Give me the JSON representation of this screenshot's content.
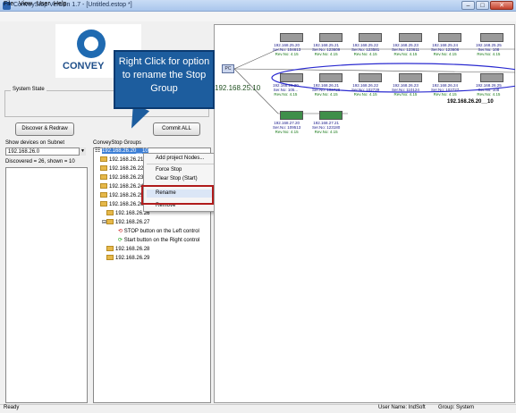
{
  "window": {
    "title": "ConveyStop Version 1.7 - [Untitled.estop *]"
  },
  "menu": [
    "File",
    "View",
    "User",
    "Help"
  ],
  "logo": {
    "text": "CONVEY"
  },
  "callout": {
    "text": "Right Click for option to rename the Stop Group"
  },
  "left": {
    "system_state_label": "System State",
    "discover_button": "Discover & Redraw",
    "commit_button": "Commit ALL",
    "subnet_label": "Show devices on Subnet",
    "subnet_value": "192.168.26.0",
    "discovered_text": "Discovered = 26, shown = 10"
  },
  "tree": {
    "label": "ConveyStop Groups",
    "root": "192.168.26.20__10",
    "rows": [
      "192.168.26.21",
      "192.168.26.22",
      "192.168.26.23",
      "192.168.26.24",
      "192.168.26.25",
      "192.168.26.26",
      "192.168.26.27",
      "STOP button on the Left control",
      "Start button on the Right control",
      "192.168.26.28",
      "192.168.26.29"
    ]
  },
  "context_menu": {
    "items": [
      "Add project Nodes...",
      "Force Stop",
      "Clear Stop (Start)",
      "Rename",
      "Remove"
    ]
  },
  "network": {
    "pc_label": "PC",
    "pc_ip": "192.168.25.10",
    "group_label": "192.168.26.20__10",
    "row1": [
      {
        "ip": "192.168.25.20",
        "ser": "Ser.No: 104613",
        "rev": "Rev.No: 4.15"
      },
      {
        "ip": "192.168.25.21",
        "ser": "Ser.No: 123609",
        "rev": "Rev.No: 4.15"
      },
      {
        "ip": "192.168.25.22",
        "ser": "Ser.No: 123581",
        "rev": "Rev.No: 4.15"
      },
      {
        "ip": "192.168.25.23",
        "ser": "Ser.No: 123611",
        "rev": "Rev.No: 4.15"
      },
      {
        "ip": "192.168.25.24",
        "ser": "Ser.No: 123606",
        "rev": "Rev.No: 4.15"
      },
      {
        "ip": "192.168.25.25",
        "ser": "Ser.No: 108",
        "rev": "Rev.No: 4.15"
      }
    ],
    "row2": [
      {
        "ip": "192.168.26.20",
        "ser": "Ser.No: 105...",
        "rev": "Rev.No: 4.15"
      },
      {
        "ip": "192.168.26.21",
        "ser": "Ser.No: 102728",
        "rev": "Rev.No: 4.15"
      },
      {
        "ip": "192.168.26.22",
        "ser": "Ser.No: 102739",
        "rev": "Rev.No: 4.15"
      },
      {
        "ip": "192.168.26.23",
        "ser": "Ser.No: 110124",
        "rev": "Rev.No: 4.15"
      },
      {
        "ip": "192.168.26.24",
        "ser": "Ser.No: 102727",
        "rev": "Rev.No: 4.15"
      },
      {
        "ip": "192.168.26.25",
        "ser": "Ser.No: 108",
        "rev": "Rev.No: 4.15"
      }
    ],
    "row3": [
      {
        "ip": "192.168.27.20",
        "ser": "Ser.No: 109513",
        "rev": "Rev.No: 4.15"
      },
      {
        "ip": "192.168.27.21",
        "ser": "Ser.No: 123180",
        "rev": "Rev.No: 4.15"
      }
    ]
  },
  "status": {
    "left": "Ready",
    "user": "User Name: IndSoft",
    "group": "Group: System"
  },
  "colors": {
    "accent": "#1d5d9e",
    "highlight_box": "#b01b1b",
    "ellipse": "#2a2ad0"
  }
}
